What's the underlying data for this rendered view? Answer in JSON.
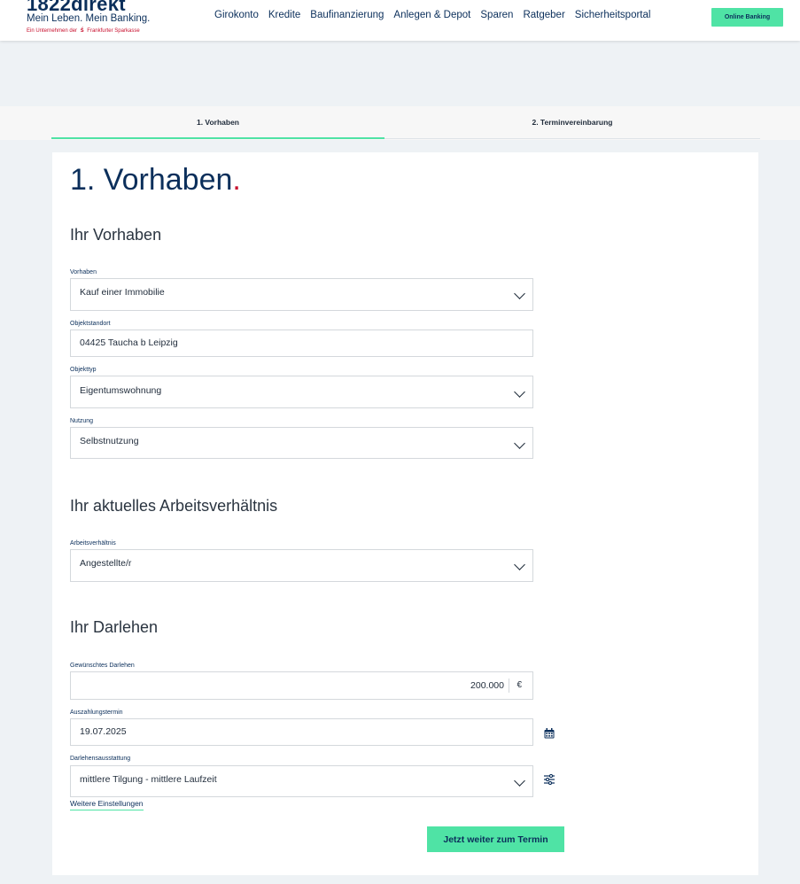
{
  "header": {
    "logo_main": "1822direkt",
    "logo_sub": "Mein Leben. Mein Banking.",
    "logo_tag_prefix": "Ein Unternehmen der",
    "logo_tag_suffix": "Frankfurter Sparkasse",
    "nav": [
      "Girokonto",
      "Kredite",
      "Baufinanzierung",
      "Anlegen & Depot",
      "Sparen",
      "Ratgeber",
      "Sicherheitsportal"
    ],
    "online_banking_label": "Online Banking"
  },
  "steps": {
    "step1": "1. Vorhaben",
    "step2": "2. Terminvereinbarung",
    "active": 1
  },
  "page": {
    "title": "1. Vorhaben",
    "title_dot": "."
  },
  "sections": {
    "vorhaben": "Ihr Vorhaben",
    "arbeit": "Ihr aktuelles Arbeitsverhältnis",
    "darlehen": "Ihr Darlehen"
  },
  "fields": {
    "vorhaben": {
      "label": "Vorhaben",
      "value": "Kauf einer Immobilie"
    },
    "objektstandort": {
      "label": "Objektstandort",
      "value": "04425 Taucha b Leipzig"
    },
    "objekttyp": {
      "label": "Objekttyp",
      "value": "Eigentumswohnung"
    },
    "nutzung": {
      "label": "Nutzung",
      "value": "Selbstnutzung"
    },
    "arbeitsverhaeltnis": {
      "label": "Arbeitsverhältnis",
      "value": "Angestellte/r"
    },
    "darlehen": {
      "label": "Gewünschtes Darlehen",
      "value": "200.000",
      "currency": "€"
    },
    "auszahlung": {
      "label": "Auszahlungstermin",
      "value": "19.07.2025"
    },
    "ausstattung": {
      "label": "Darlehensausstattung",
      "value": "mittlere Tilgung - mittlere Laufzeit"
    }
  },
  "links": {
    "weitere": "Weitere Einstellungen"
  },
  "buttons": {
    "next": "Jetzt weiter zum Termin"
  },
  "colors": {
    "brand_navy": "#0b2f5b",
    "accent_green": "#4fe3a5",
    "brand_red": "#c8102e"
  },
  "icons": {
    "calendar": "calendar-icon",
    "settings": "sliders-icon",
    "dropdown": "chevron-down-icon"
  }
}
